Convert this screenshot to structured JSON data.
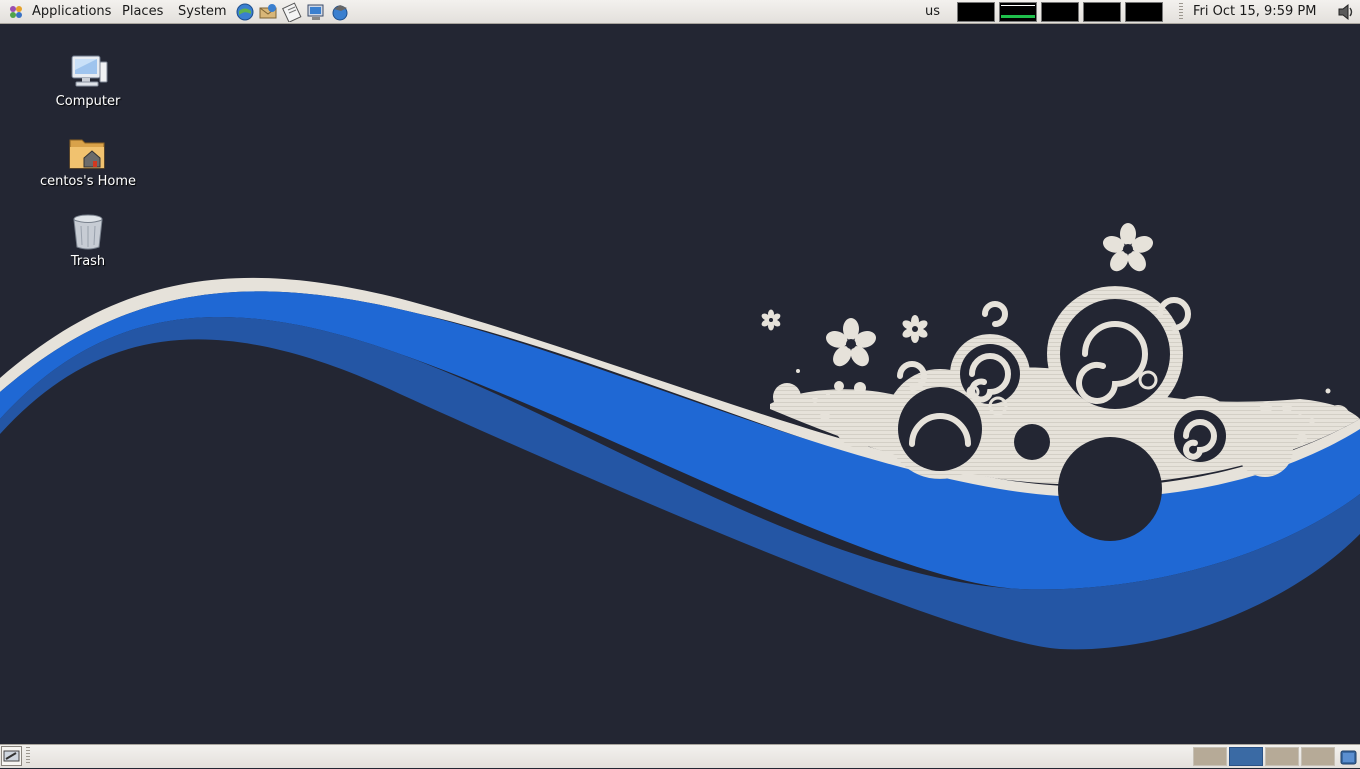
{
  "top_panel": {
    "menus": {
      "applications": "Applications",
      "places": "Places",
      "system": "System"
    },
    "launchers": [
      "web-browser-icon",
      "email-client-icon",
      "text-editor-icon",
      "network-icon",
      "help-icon"
    ],
    "keyboard_layout": "us",
    "clock": "Fri Oct 15,  9:59 PM"
  },
  "desktop": {
    "icons": [
      {
        "label": "Computer",
        "icon": "computer-icon"
      },
      {
        "label": "centos's Home",
        "icon": "home-folder-icon"
      },
      {
        "label": "Trash",
        "icon": "trash-icon"
      }
    ]
  },
  "bottom_panel": {
    "workspaces": 4,
    "active_workspace": 2
  },
  "colors": {
    "wallpaper_bg": "#232633",
    "wave_blue": "#1f68d4",
    "wave_dark_blue": "#2456a5",
    "ornament": "#e6e2da",
    "panel": "#ece9e5",
    "active_workspace": "#3a6aa4",
    "inactive_workspace": "#b6aa97"
  }
}
